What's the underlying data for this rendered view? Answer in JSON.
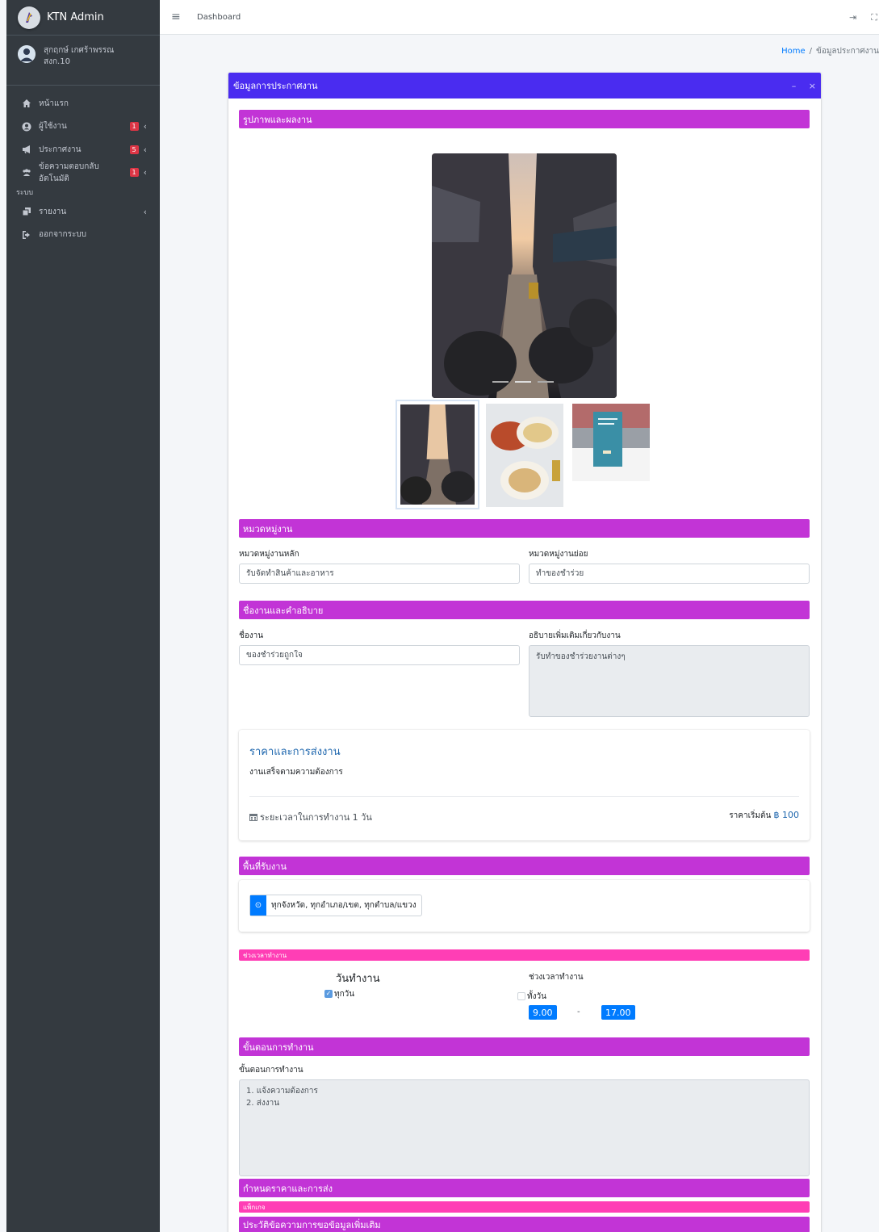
{
  "sidebar": {
    "brand": "KTN Admin",
    "user_name_line1": "สุกฤกษ์ เกศร้าพรรณ",
    "user_name_line2": "สงก.10",
    "items": [
      {
        "label": "หน้าแรก",
        "icon": "home-icon"
      },
      {
        "label": "ผู้ใช้งาน",
        "icon": "user-circle-icon",
        "badge": "1"
      },
      {
        "label": "ประกาศงาน",
        "icon": "megaphone-icon",
        "badge": "5"
      },
      {
        "label": "ข้อความตอบกลับอัตโนมัติ",
        "icon": "users-icon",
        "badge": "1"
      }
    ],
    "section_header": "ระบบ",
    "system_items": [
      {
        "label": "รายงาน",
        "icon": "copy-icon"
      },
      {
        "label": "ออกจากระบบ",
        "icon": "sign-out-icon"
      }
    ]
  },
  "topbar": {
    "link": "Dashboard"
  },
  "breadcrumb": {
    "home": "Home",
    "separator": "/",
    "current": "ข้อมูลประกาศงาน"
  },
  "card": {
    "title": "ข้อมูลการประกาศงาน",
    "collapse": "–",
    "close": "×"
  },
  "sections": {
    "photos": "รูปภาพและผลงาน",
    "category": "หมวดหมู่งาน",
    "name_desc": "ชื่องานและคำอธิบาย",
    "area": "พื้นที่รับงาน",
    "work_time": "ช่วงเวลาทำงาน",
    "steps": "ขั้นตอนการทำงาน",
    "pricing": "กำหนดราคาและการส่ง",
    "package": "แพ็กเกจ",
    "history": "ประวัติข้อความการขอข้อมูลเพิ่มเติม"
  },
  "category": {
    "main_label": "หมวดหมู่งานหลัก",
    "main_value": "รับจัดทำสินค้าและอาหาร",
    "sub_label": "หมวดหมู่งานย่อย",
    "sub_value": "ทำของชำร่วย"
  },
  "job": {
    "name_label": "ชื่องาน",
    "name_value": "ของชำร่วยถูกใจ",
    "desc_label": "อธิบายเพิ่มเติมเกี่ยวกับงาน",
    "desc_value": "รับทำของชำร่วยงานต่างๆ"
  },
  "price": {
    "title": "ราคาและการส่งงาน",
    "desc": "งานเสร็จตามความต้องการ",
    "duration": "ระยะเวลาในการทำงาน 1 วัน",
    "start_label": "ราคาเริ่มต้น",
    "start_amount": "฿ 100"
  },
  "area": {
    "value": "ทุกจังหวัด, ทุกอำเภอ/เขต, ทุกตำบล/แขวง"
  },
  "work_time": {
    "days_title": "วันทำงาน",
    "days_option": "ทุกวัน",
    "days_checked": true,
    "hours_title": "ช่วงเวลาทำงาน",
    "hours_option": "ทั้งวัน",
    "hours_checked": false,
    "start": "9.00",
    "dash": "-",
    "end": "17.00"
  },
  "steps": {
    "label": "ขั้นตอนการทำงาน",
    "value": "1. แจ้งความต้องการ\n2. ส่งงาน"
  },
  "colors": {
    "sidebar": "#343a40",
    "card_header": "#4a2cf0",
    "section_bar": "#c234d6",
    "section_bar_small": "#ff3eb5",
    "primary": "#007bff"
  }
}
